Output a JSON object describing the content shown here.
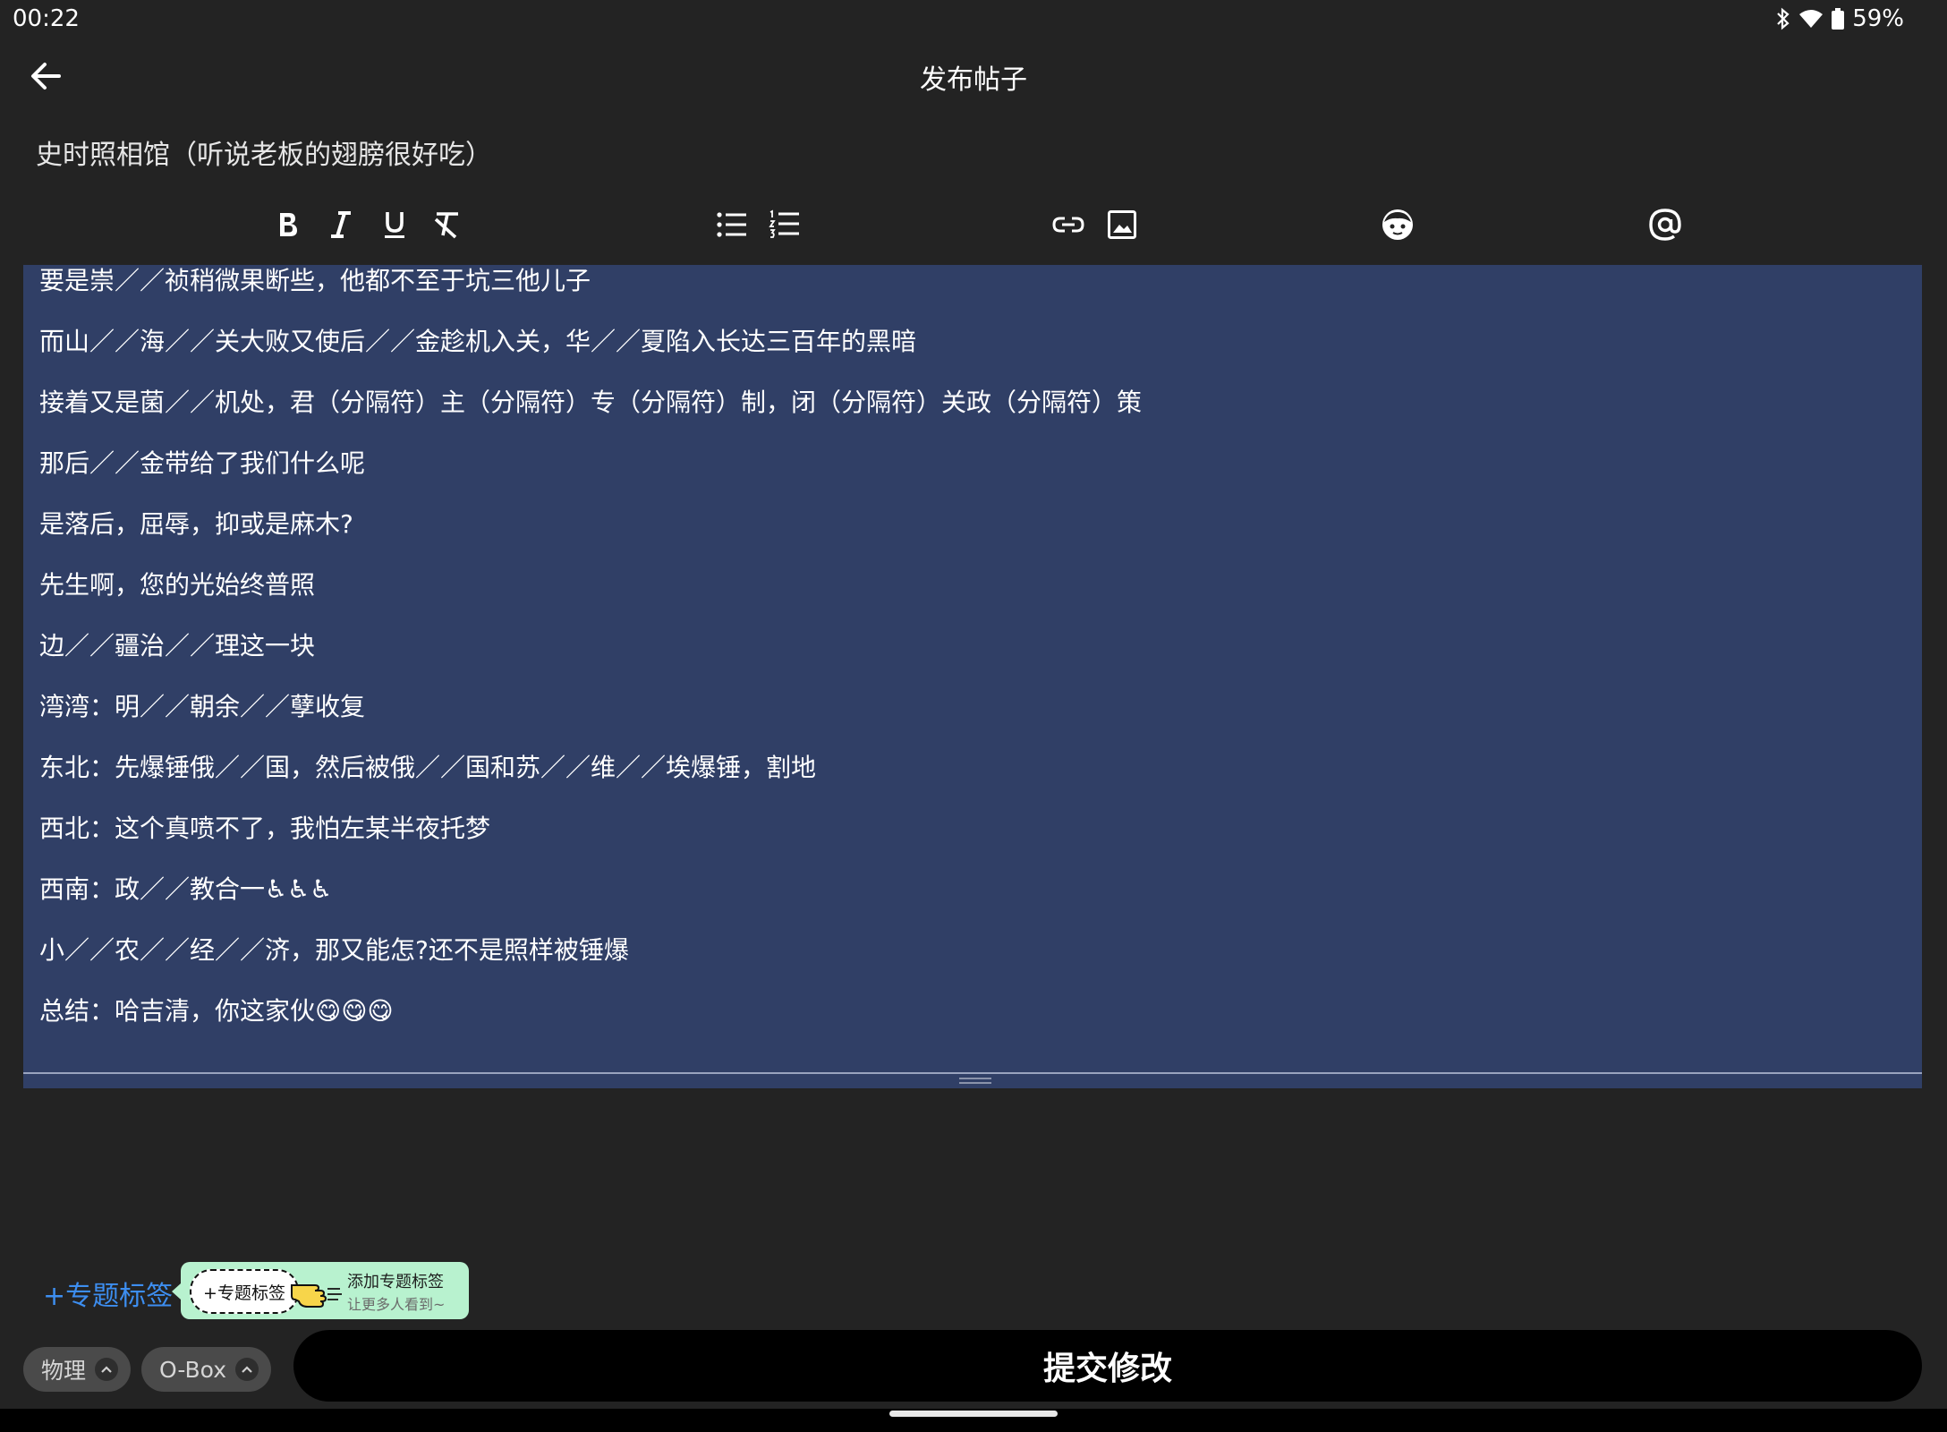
{
  "status_bar": {
    "time": "00:22",
    "battery": "59%",
    "icons": [
      "bluetooth-icon",
      "wifi-icon",
      "battery-icon"
    ]
  },
  "header": {
    "title": "发布帖子",
    "back_icon": "arrow-left-icon"
  },
  "post_title": "史时照相馆（听说老板的翅膀很好吃）",
  "toolbar": {
    "buttons": [
      "bold-icon",
      "italic-icon",
      "underline-icon",
      "clear-format-icon",
      "bullet-list-icon",
      "numbered-list-icon",
      "link-icon",
      "image-icon",
      "emoji-icon",
      "mention-icon"
    ]
  },
  "editor": {
    "background": "#303f66",
    "lines": [
      "要是崇／／祯稍微果断些，他都不至于坑三他儿子",
      "而山／／海／／关大败又使后／／金趁机入关，华／／夏陷入长达三百年的黑暗",
      "接着又是菌／／机处，君（分隔符）主（分隔符）专（分隔符）制，闭（分隔符）关政（分隔符）策",
      "那后／／金带给了我们什么呢",
      "是落后，屈辱，抑或是麻木?",
      "先生啊，您的光始终普照",
      "边／／疆治／／理这一块",
      "湾湾：明／／朝余／／孽收复",
      "东北：先爆锤俄／／国，然后被俄／／国和苏／／维／／埃爆锤，割地",
      "西北：这个真喷不了，我怕左某半夜托梦",
      "西南：政／／教合一♿♿♿",
      "小／／农／／经／／济，那又能怎?还不是照样被锤爆",
      "总结：哈吉清，你这家伙😋😋😋"
    ]
  },
  "topic": {
    "add_label": "+专题标签",
    "tooltip_chip": "+专题标签",
    "tooltip_title": "添加专题标签",
    "tooltip_sub": "让更多人看到~"
  },
  "tags": [
    {
      "label": "物理"
    },
    {
      "label": "O-Box"
    }
  ],
  "submit_label": "提交修改",
  "colors": {
    "background": "#232323",
    "accent": "#3d8ef0",
    "tooltip": "#b8f2cf"
  }
}
